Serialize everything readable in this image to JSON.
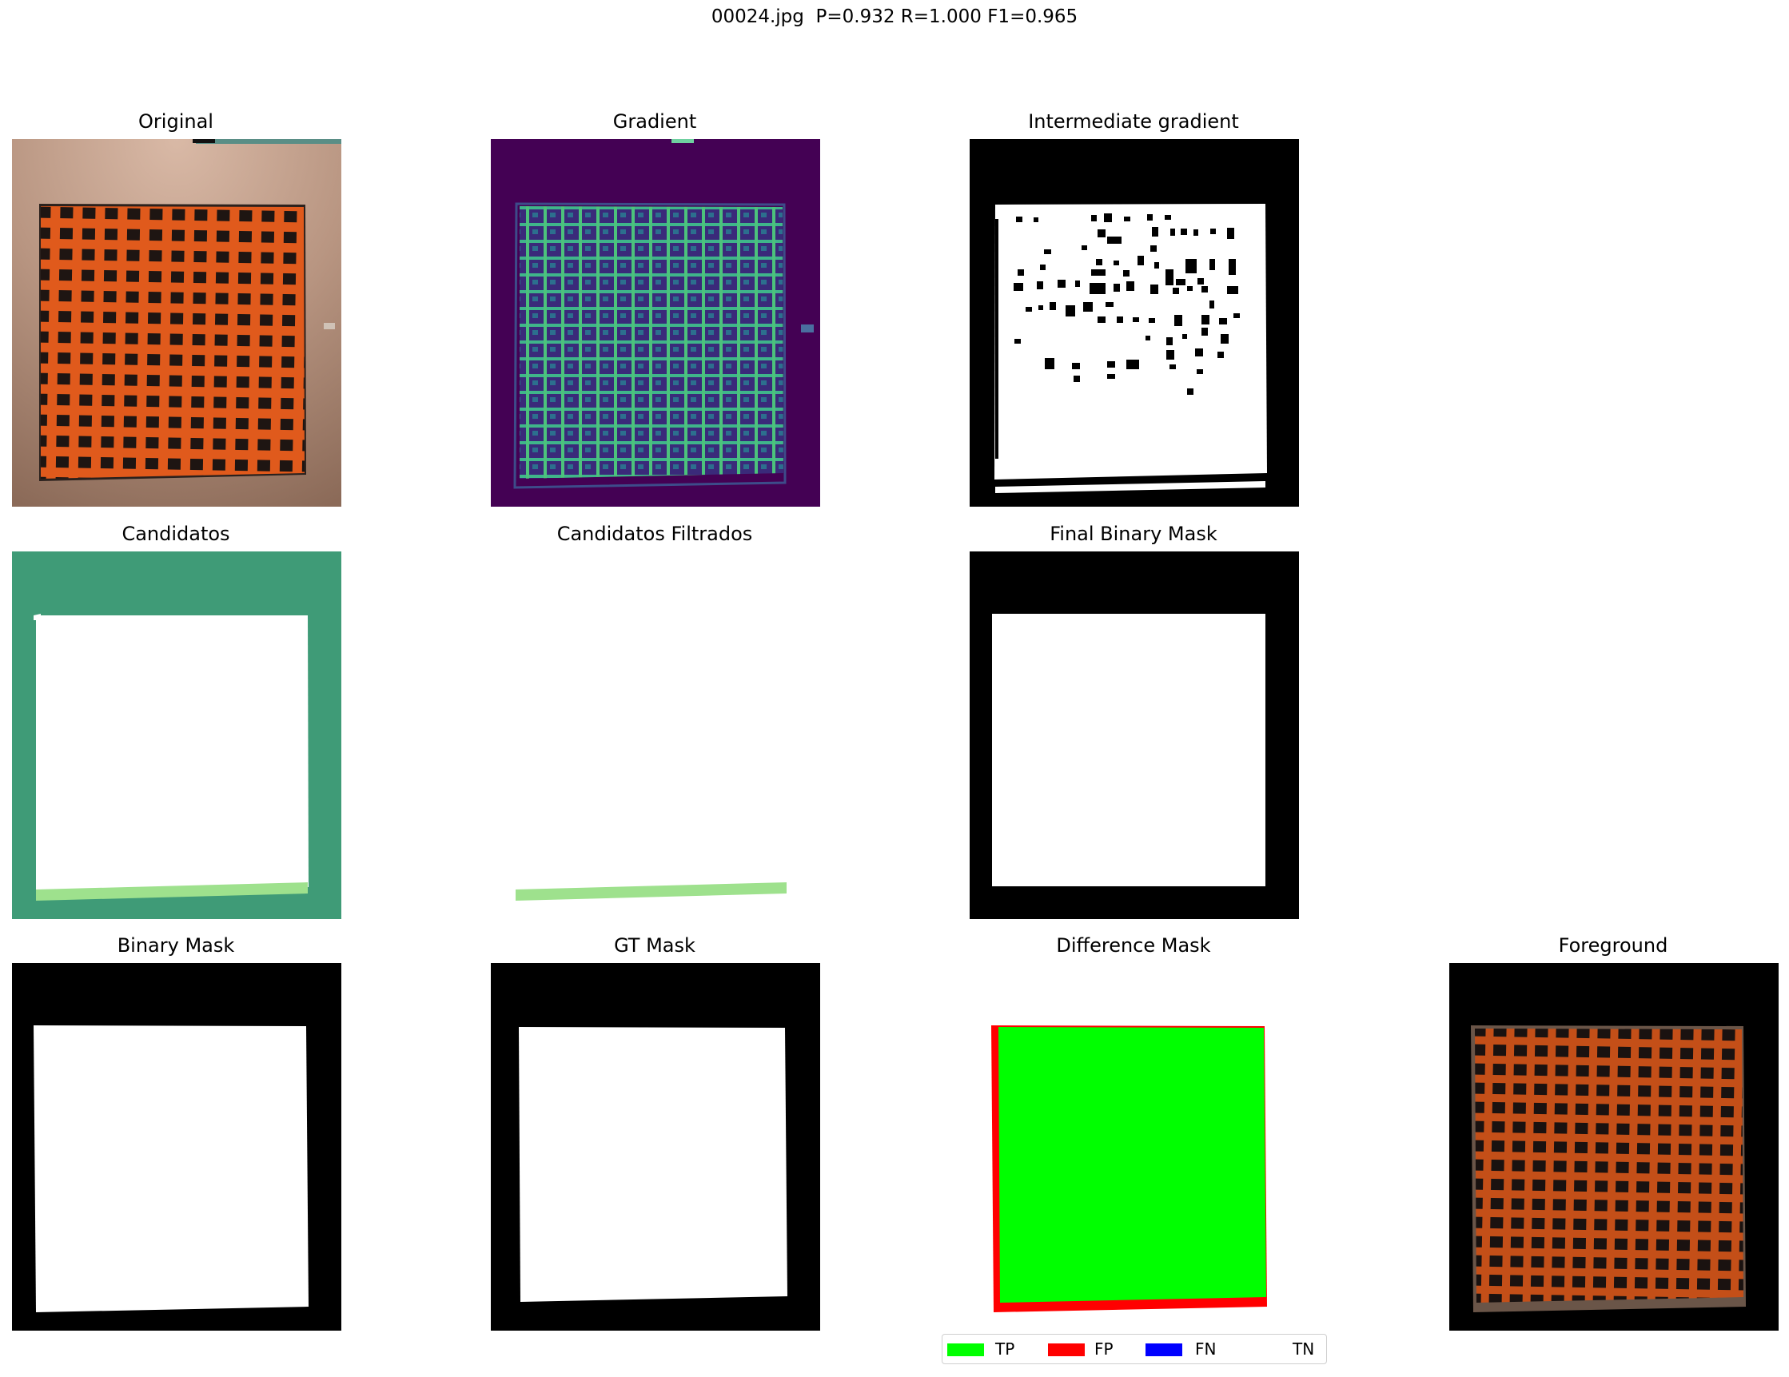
{
  "figure": {
    "title": "00024.jpg  P=0.932 R=1.000 F1=0.965"
  },
  "panels": {
    "original": {
      "title": "Original"
    },
    "gradient": {
      "title": "Gradient"
    },
    "intermediate_gradient": {
      "title": "Intermediate gradient"
    },
    "candidatos": {
      "title": "Candidatos"
    },
    "candidatos_filtrados": {
      "title": "Candidatos Filtrados"
    },
    "final_binary_mask": {
      "title": "Final Binary Mask"
    },
    "binary_mask": {
      "title": "Binary Mask"
    },
    "gt_mask": {
      "title": "GT Mask"
    },
    "difference_mask": {
      "title": "Difference Mask"
    },
    "foreground": {
      "title": "Foreground"
    }
  },
  "legend": {
    "items": [
      {
        "label": "TP",
        "color": "#00ff00"
      },
      {
        "label": "FP",
        "color": "#ff0000"
      },
      {
        "label": "FN",
        "color": "#0000ff"
      },
      {
        "label": "TN",
        "color": "#ffffff"
      }
    ]
  },
  "colors": {
    "painting_orange": "#e05a1c",
    "painting_dark": "#1e1512",
    "gradient_bg": "#440154",
    "gradient_line": "#3fb58a",
    "candidate_bg": "#3f9b77",
    "candidate_strip": "#9ee18d",
    "mask_black": "#000000",
    "mask_white": "#ffffff"
  }
}
